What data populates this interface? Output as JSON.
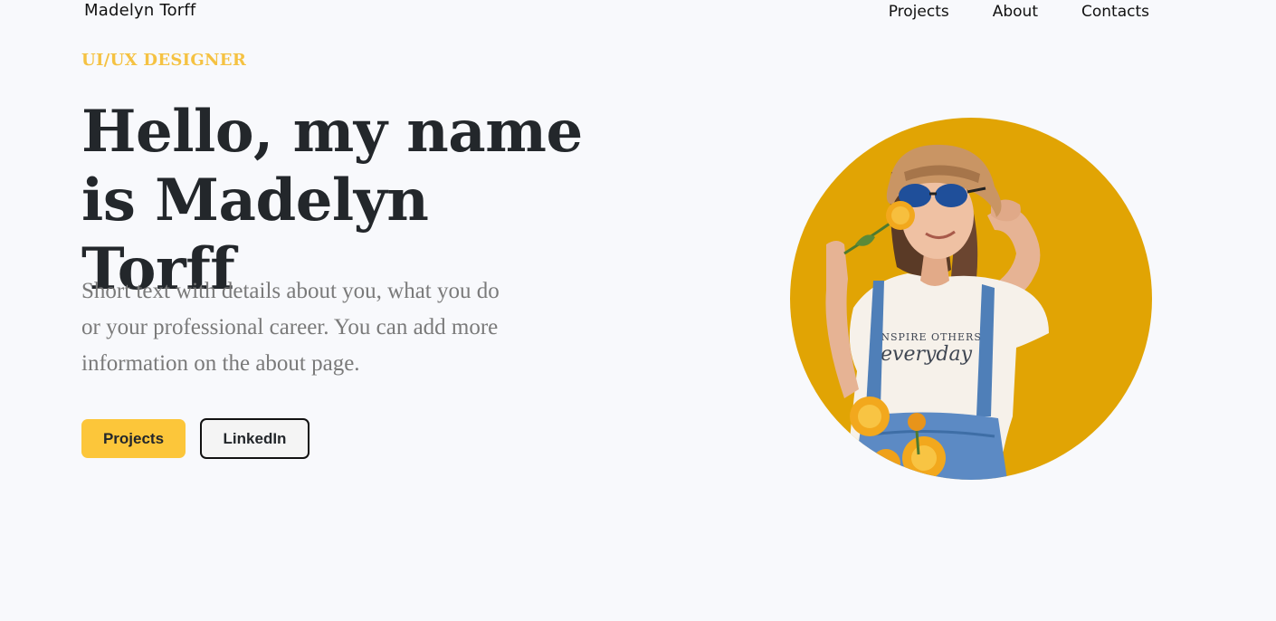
{
  "header": {
    "brand": "Madelyn Torff",
    "nav": [
      "Projects",
      "About",
      "Contacts"
    ]
  },
  "hero": {
    "eyebrow": "UI/UX DESIGNER",
    "headline_line1": "Hello, my name",
    "headline_line2": "is Madelyn Torff",
    "intro": "Short text with details about you, what you do or your professional career. You can add more information on the about page.",
    "buttons": {
      "projects": "Projects",
      "linkedin": "LinkedIn"
    }
  },
  "portrait": {
    "shirt_text_line1": "INSPIRE OTHERS",
    "shirt_text_line2": "everyday"
  },
  "colors": {
    "accent": "#fcc63a",
    "eyebrow": "#f5c242",
    "circle": "#e1a404",
    "heading": "#23272b",
    "body_text": "#7a7a7a",
    "background": "#f8f9fc"
  }
}
